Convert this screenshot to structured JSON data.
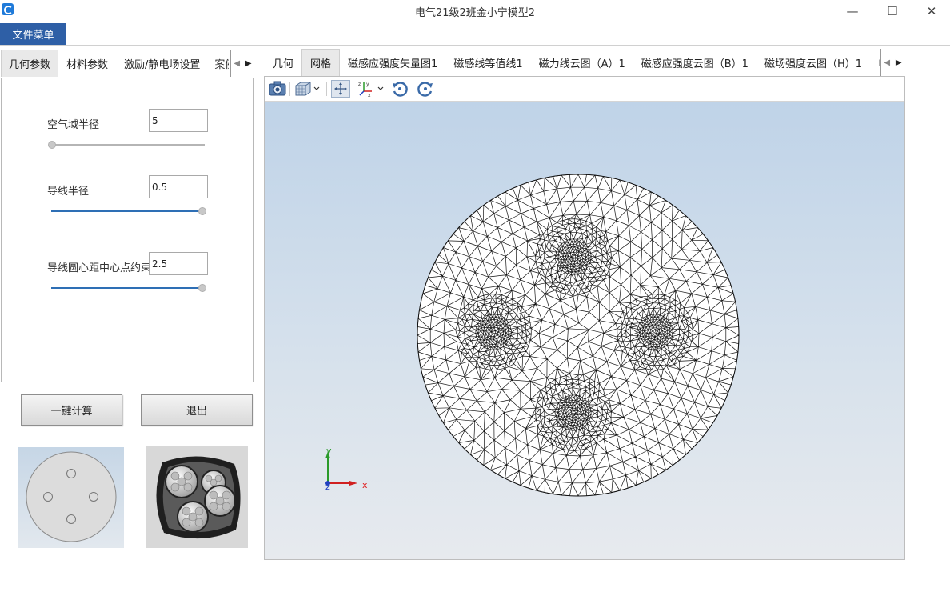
{
  "window": {
    "title": "电气21级2班金小宁模型2",
    "minimize": "—",
    "maximize": "☐",
    "close": "✕"
  },
  "menu": {
    "file": "文件菜单"
  },
  "left_tabs": [
    "几何参数",
    "材料参数",
    "激励/静电场设置",
    "案例"
  ],
  "params": [
    {
      "label": "空气域半径",
      "value": "5",
      "slider_fraction": 0.0
    },
    {
      "label": "导线半径",
      "value": "0.5",
      "slider_fraction": 1.0
    },
    {
      "label": "导线圆心距中心点约束",
      "value": "2.5",
      "slider_fraction": 1.0
    }
  ],
  "buttons": {
    "compute": "一键计算",
    "exit": "退出"
  },
  "right_tabs": [
    "几何",
    "网格",
    "磁感应强度矢量图1",
    "磁感线等值线1",
    "磁力线云图（A）1",
    "磁感应强度云图（B）1",
    "磁场强度云图（H）1",
    "电流密"
  ],
  "right_active_tab": 1,
  "toolbar_icons": [
    "camera-icon",
    "cube-view-icon",
    "chevron-down-icon",
    "fit-view-icon",
    "axes-orientation-icon",
    "chevron-down-icon",
    "rotate-left-icon",
    "rotate-right-icon"
  ],
  "axes": {
    "x": "x",
    "y": "y",
    "z": "z"
  },
  "colors": {
    "accent": "#2e5fa6",
    "slider_active": "#2e6fb5",
    "slider_inactive": "#b5b5b5",
    "axis_x": "#e02020",
    "axis_y": "#20a020",
    "axis_z": "#2040c0"
  }
}
